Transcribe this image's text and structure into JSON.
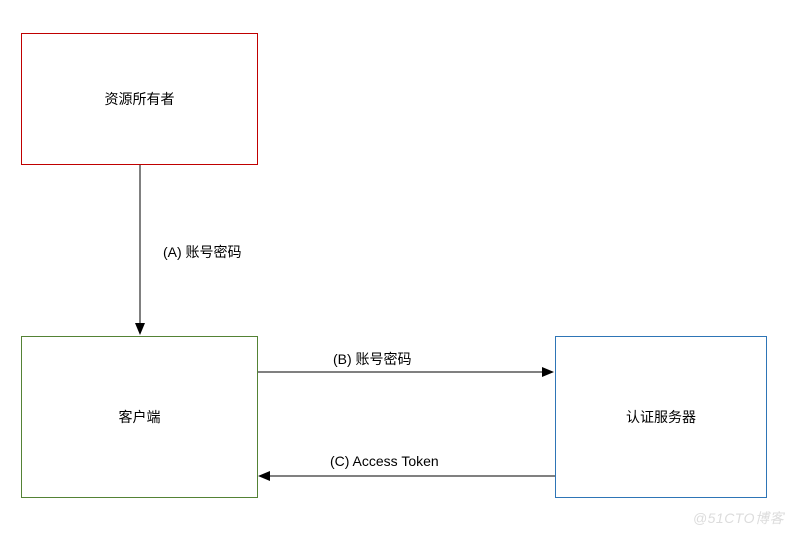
{
  "chart_data": {
    "type": "flow",
    "nodes": [
      {
        "id": "resource-owner",
        "label": "资源所有者",
        "color": "#c00000"
      },
      {
        "id": "client",
        "label": "客户端",
        "color": "#548235"
      },
      {
        "id": "auth-server",
        "label": "认证服务器",
        "color": "#2e75b6"
      }
    ],
    "edges": [
      {
        "id": "A",
        "from": "resource-owner",
        "to": "client",
        "label": "(A) 账号密码"
      },
      {
        "id": "B",
        "from": "client",
        "to": "auth-server",
        "label": "(B) 账号密码"
      },
      {
        "id": "C",
        "from": "auth-server",
        "to": "client",
        "label": "(C) Access Token"
      }
    ]
  },
  "boxes": {
    "resource_owner": "资源所有者",
    "client": "客户端",
    "auth_server": "认证服务器"
  },
  "labels": {
    "a": "(A) 账号密码",
    "b": "(B) 账号密码",
    "c": "(C) Access Token"
  },
  "watermark": "@51CTO博客"
}
